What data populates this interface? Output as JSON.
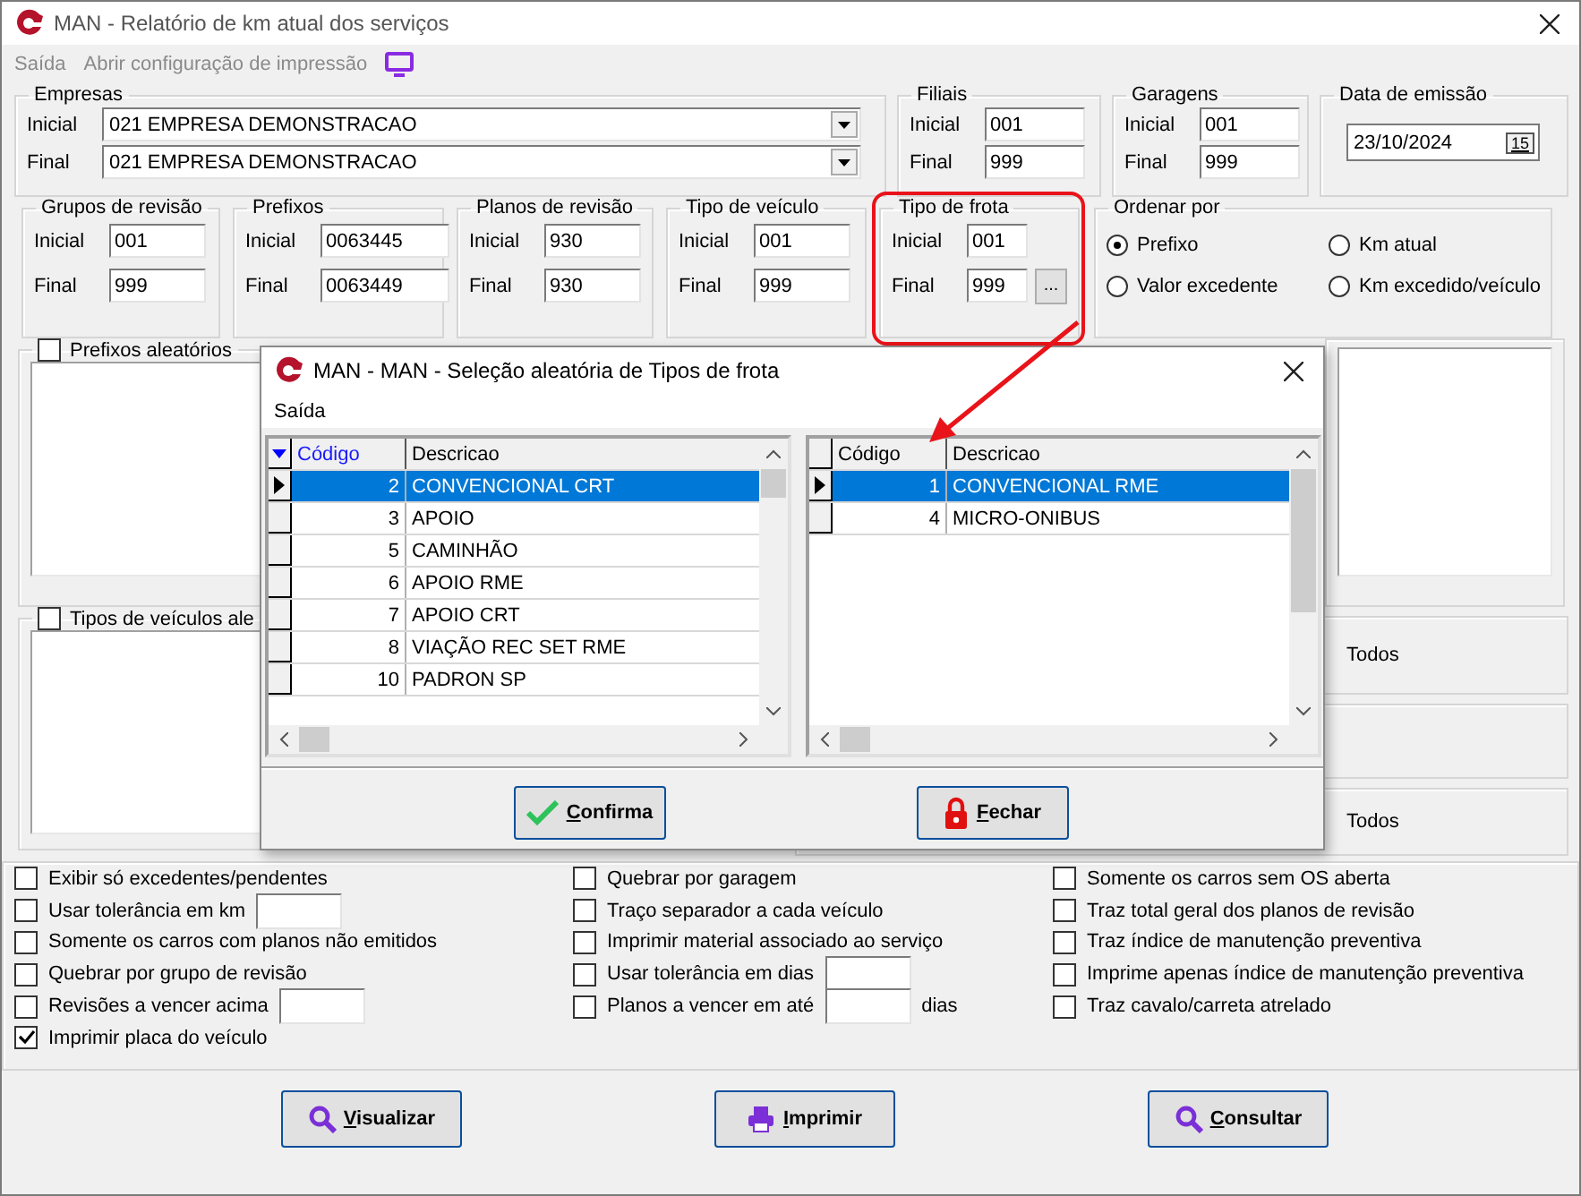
{
  "window": {
    "title": "MAN - Relatório de km atual dos serviços"
  },
  "menu": [
    {
      "label": "Saída"
    },
    {
      "label": "Abrir configuração de impressão"
    }
  ],
  "empresas": {
    "title": "Empresas",
    "fields": [
      {
        "label": "Inicial",
        "value": "021 EMPRESA DEMONSTRACAO"
      },
      {
        "label": "Final",
        "value": "021 EMPRESA DEMONSTRACAO"
      }
    ]
  },
  "top_ranges": [
    {
      "title": "Filiais",
      "fields": [
        {
          "label": "Inicial",
          "value": "001"
        },
        {
          "label": "Final",
          "value": "999"
        }
      ]
    },
    {
      "title": "Garagens",
      "fields": [
        {
          "label": "Inicial",
          "value": "001"
        },
        {
          "label": "Final",
          "value": "999"
        }
      ]
    }
  ],
  "data_emissao": {
    "title": "Data de emissão",
    "value": "23/10/2024",
    "calendar_label": "15"
  },
  "ranges": [
    {
      "title": "Grupos de revisão",
      "highlighted": false,
      "fields": [
        {
          "label": "Inicial",
          "value": "001"
        },
        {
          "label": "Final",
          "value": "999"
        }
      ]
    },
    {
      "title": "Prefixos",
      "highlighted": false,
      "fields": [
        {
          "label": "Inicial",
          "value": "0063445"
        },
        {
          "label": "Final",
          "value": "0063449"
        }
      ]
    },
    {
      "title": "Planos de revisão",
      "highlighted": false,
      "fields": [
        {
          "label": "Inicial",
          "value": "930"
        },
        {
          "label": "Final",
          "value": "930"
        }
      ]
    },
    {
      "title": "Tipo de veículo",
      "highlighted": false,
      "fields": [
        {
          "label": "Inicial",
          "value": "001"
        },
        {
          "label": "Final",
          "value": "999"
        }
      ]
    },
    {
      "title": "Tipo de frota",
      "highlighted": true,
      "lookup": "...",
      "fields": [
        {
          "label": "Inicial",
          "value": "001"
        },
        {
          "label": "Final",
          "value": "999"
        }
      ]
    }
  ],
  "ordenar_por": {
    "title": "Ordenar por",
    "options": [
      {
        "label": "Prefixo",
        "selected": true
      },
      {
        "label": "Km atual",
        "selected": false
      },
      {
        "label": "Valor excedente",
        "selected": false
      },
      {
        "label": "Km excedido/veículo",
        "selected": false
      }
    ]
  },
  "prefixos_aleatorios": {
    "label": "Prefixos aleatórios",
    "checked": false
  },
  "tipos_veiculos_aleatorios": {
    "label": "Tipos de veículos ale",
    "checked": false
  },
  "todos": [
    {
      "label": "Todos"
    },
    {
      "label": "Todos"
    }
  ],
  "options": {
    "columns": [
      [
        {
          "label": "Exibir só excedentes/pendentes",
          "checked": false,
          "kind": "plain"
        },
        {
          "label": "Usar tolerância em km",
          "checked": false,
          "kind": "field"
        },
        {
          "label": "Somente os carros com planos não emitidos",
          "checked": false,
          "kind": "plain"
        },
        {
          "label": "Quebrar por grupo de revisão",
          "checked": false,
          "kind": "plain"
        },
        {
          "label": "Revisões a vencer acima",
          "checked": false,
          "kind": "field"
        },
        {
          "label": "Imprimir placa do veículo",
          "checked": true,
          "kind": "plain"
        }
      ],
      [
        {
          "label": "Quebrar por garagem",
          "checked": false,
          "kind": "plain"
        },
        {
          "label": "Traço separador a cada veículo",
          "checked": false,
          "kind": "plain"
        },
        {
          "label": "Imprimir material associado ao serviço",
          "checked": false,
          "kind": "plain"
        },
        {
          "label": "Usar tolerância em dias",
          "checked": false,
          "kind": "field"
        },
        {
          "label": "Planos a vencer em até",
          "checked": false,
          "kind": "field",
          "suffix": "dias"
        }
      ],
      [
        {
          "label": "Somente os carros sem OS aberta",
          "checked": false,
          "kind": "plain"
        },
        {
          "label": "Traz total geral dos planos de revisão",
          "checked": false,
          "kind": "plain"
        },
        {
          "label": "Traz índice de manutenção preventiva",
          "checked": false,
          "kind": "plain"
        },
        {
          "label": "Imprime apenas índice de manutenção preventiva",
          "checked": false,
          "kind": "plain"
        },
        {
          "label": "Traz cavalo/carreta atrelado",
          "checked": false,
          "kind": "plain"
        }
      ]
    ]
  },
  "buttons": [
    {
      "label": "Visualizar"
    },
    {
      "label": "Imprimir"
    },
    {
      "label": "Consultar"
    }
  ],
  "dialog": {
    "title": "MAN - MAN - Seleção aleatória de Tipos de frota",
    "menu": "Saída",
    "grids": [
      {
        "sorted": true,
        "columns": [
          "Código",
          "Descricao"
        ],
        "rows": [
          {
            "code": "2",
            "description": "CONVENCIONAL CRT",
            "selected": true
          },
          {
            "code": "3",
            "description": "APOIO",
            "selected": false
          },
          {
            "code": "5",
            "description": "CAMINHÃO",
            "selected": false
          },
          {
            "code": "6",
            "description": "APOIO RME",
            "selected": false
          },
          {
            "code": "7",
            "description": "APOIO CRT",
            "selected": false
          },
          {
            "code": "8",
            "description": "VIAÇÃO REC SET RME",
            "selected": false
          },
          {
            "code": "10",
            "description": "PADRON SP",
            "selected": false
          }
        ]
      },
      {
        "sorted": false,
        "columns": [
          "Código",
          "Descricao"
        ],
        "rows": [
          {
            "code": "1",
            "description": "CONVENCIONAL RME",
            "selected": true
          },
          {
            "code": "4",
            "description": "MICRO-ONIBUS",
            "selected": false
          }
        ]
      }
    ],
    "buttons": [
      {
        "label": "Confirma"
      },
      {
        "label": "Fechar"
      }
    ]
  }
}
